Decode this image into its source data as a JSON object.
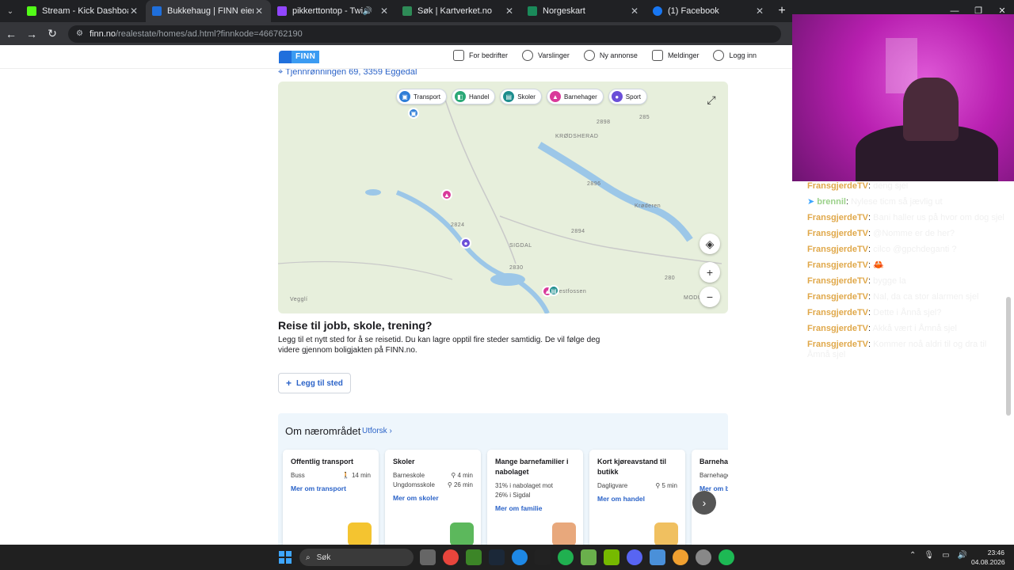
{
  "browser": {
    "tabs": [
      {
        "title": "Stream - Kick Dashboard",
        "color": "#53fc18"
      },
      {
        "title": "Bukkehaug | FINN eiendom",
        "color": "#1f6fdc",
        "active": true
      },
      {
        "title": "pikkerttontop - Twitch",
        "color": "#9146ff",
        "sound": true
      },
      {
        "title": "Søk | Kartverket.no",
        "color": "#2e8b57"
      },
      {
        "title": "Norgeskart",
        "color": "#1a8a5a"
      },
      {
        "title": "(1) Facebook",
        "color": "#1877f2"
      }
    ],
    "url_domain": "finn.no",
    "url_path": "/realestate/homes/ad.html?finnkode=466762190"
  },
  "finn_header": {
    "logo": "FINN",
    "nav": [
      "For bedrifter",
      "Varslinger",
      "Ny annonse",
      "Meldinger",
      "Logg inn"
    ]
  },
  "listing": {
    "address": "Tjennrønningen 69, 3359 Eggedal",
    "map": {
      "chips": [
        "Transport",
        "Handel",
        "Skoler",
        "Barnehager",
        "Sport"
      ],
      "labels": [
        "KRØDSHERAD",
        "SIGDAL",
        "Krøderen",
        "Vestfossen",
        "Vegglí",
        "MODU"
      ],
      "road_numbers": [
        "2898",
        "285",
        "2896",
        "2824",
        "2894",
        "2830",
        "280"
      ],
      "zoom_in": "+",
      "zoom_out": "−"
    },
    "travel": {
      "heading": "Reise til jobb, skole, trening?",
      "text": "Legg til et nytt sted for å se reisetid. Du kan lagre opptil fire steder samtidig. De vil følge deg videre gjennom boligjakten på FINN.no.",
      "add_button": "Legg til sted"
    },
    "nearby": {
      "title": "Om nærområdet",
      "link": "Utforsk",
      "cards": [
        {
          "title": "Offentlig transport",
          "rows": [
            [
              "Buss",
              "14 min"
            ]
          ],
          "link": "Mer om transport",
          "color": "#f4c430"
        },
        {
          "title": "Skoler",
          "rows": [
            [
              "Barneskole",
              "4 min"
            ],
            [
              "Ungdomsskole",
              "26 min"
            ]
          ],
          "link": "Mer om skoler",
          "color": "#5cb85c"
        },
        {
          "title": "Mange barnefamilier i nabolaget",
          "rows": [
            [
              "31% i nabolaget mot",
              ""
            ],
            [
              "26% i Sigdal",
              ""
            ]
          ],
          "link": "Mer om familie",
          "color": "#e8a87c"
        },
        {
          "title": "Kort kjøreavstand til butikk",
          "rows": [
            [
              "Dagligvare",
              "5 min"
            ]
          ],
          "link": "Mer om handel",
          "color": "#f0c060"
        },
        {
          "title": "Barnehage",
          "rows": [
            [
              "Barnehage",
              ""
            ]
          ],
          "link": "Mer om ba",
          "color": "#7fb3e6"
        }
      ]
    }
  },
  "chat": {
    "messages": [
      {
        "user": "FransgjerdeTV",
        "text": "deng sjel"
      },
      {
        "user": "brennil",
        "text": "Nylese ticm så jævlig ut",
        "green": true
      },
      {
        "user": "FransgjerdeTV",
        "text": "Bani haller us på hvor om dog sjel"
      },
      {
        "user": "FransgjerdeTV",
        "text": "@Nomme er de her?"
      },
      {
        "user": "FransgjerdeTV",
        "text": "cilco @gpchdeganti ?"
      },
      {
        "user": "FransgjerdeTV",
        "text": "🦀"
      },
      {
        "user": "FransgjerdeTV",
        "text": "bygge la"
      },
      {
        "user": "FransgjerdeTV",
        "text": "Nal, da ca stor alarmen sjel"
      },
      {
        "user": "FransgjerdeTV",
        "text": "Dette i Ånnå sjel?"
      },
      {
        "user": "FransgjerdeTV",
        "text": "Akkå vært i Åmnå sjel"
      },
      {
        "user": "FransgjerdeTV",
        "text": "Kommer noå aldri til og dra til Åmnå sjel"
      }
    ]
  },
  "taskbar": {
    "search": "Søk",
    "time": "23:46",
    "date": "04.08.2026"
  }
}
